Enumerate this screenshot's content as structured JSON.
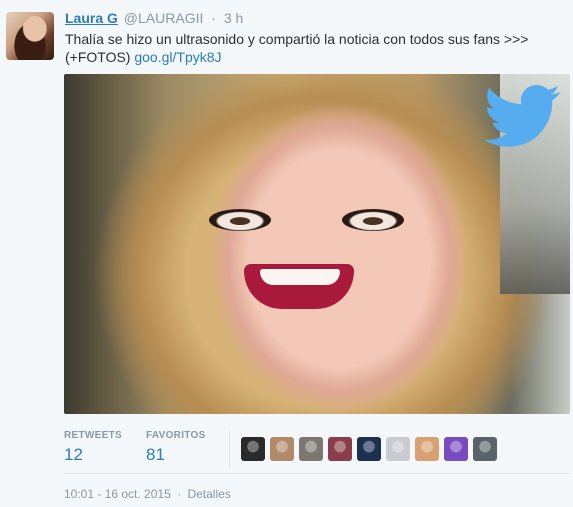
{
  "tweet": {
    "name": "Laura G",
    "screen_name": "@LAURAGII",
    "separator": "·",
    "time_ago": "3 h",
    "text": "Thalía se hizo un ultrasonido y compartió la noticia con todos sus fans >>> (+FOTOS) ",
    "link": "goo.gl/Tpyk8J"
  },
  "stats": {
    "retweets_label": "RETWEETS",
    "retweets": "12",
    "favorites_label": "FAVORITOS",
    "favorites": "81"
  },
  "favoriters": [
    {
      "icon": "favoriter-avatar",
      "color": "#2a2a2a"
    },
    {
      "icon": "favoriter-avatar",
      "color": "#b28a6a"
    },
    {
      "icon": "favoriter-avatar",
      "color": "#7c7870"
    },
    {
      "icon": "favoriter-avatar",
      "color": "#8a3d4a"
    },
    {
      "icon": "favoriter-avatar",
      "color": "#1e3050"
    },
    {
      "icon": "favoriter-avatar",
      "color": "#c8ccd0"
    },
    {
      "icon": "favoriter-avatar",
      "color": "#d9a173"
    },
    {
      "icon": "favoriter-avatar",
      "color": "#7a4bc0"
    },
    {
      "icon": "favoriter-avatar",
      "color": "#5a6468"
    }
  ],
  "meta": {
    "timestamp": "10:01 - 16 oct. 2015",
    "separator": "·",
    "details_label": "Detalles"
  },
  "colors": {
    "link": "#2b7bb9",
    "muted": "#8899a6",
    "twitter_blue": "#55acee"
  },
  "icons": {
    "photo_overlay": "twitter-bird-icon"
  }
}
